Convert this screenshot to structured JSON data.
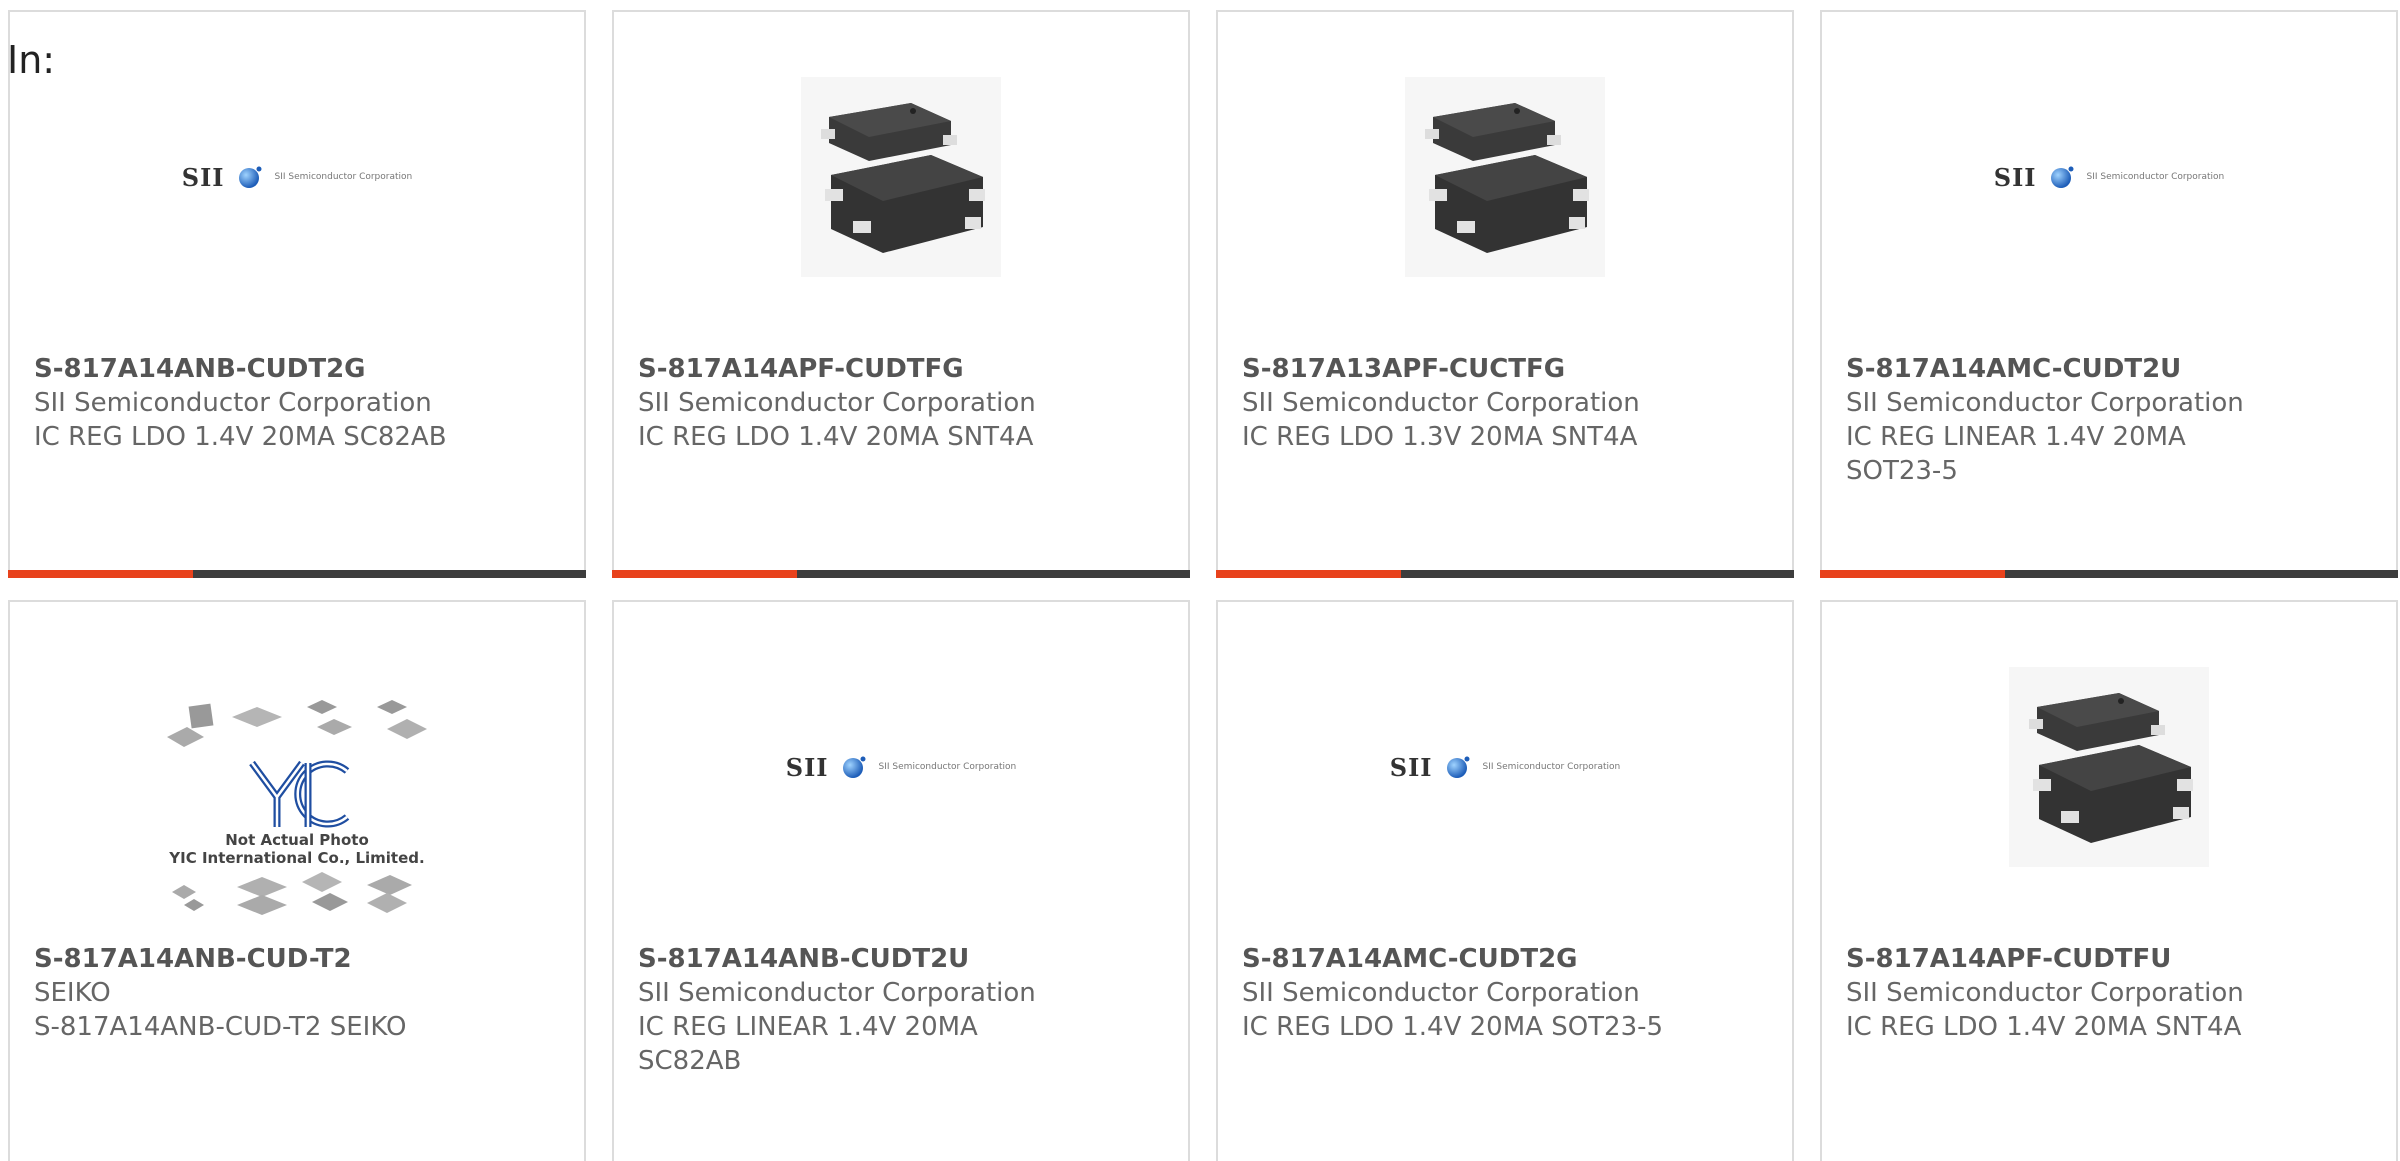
{
  "header": {
    "in_label": "In:"
  },
  "colors": {
    "accent": "#e8421c",
    "bar_track": "#3d3d3d",
    "card_border": "#dcdcdc",
    "text_main": "#666666",
    "text_bold": "#555555"
  },
  "products": [
    {
      "part_number": "S-817A14ANB-CUDT2G",
      "manufacturer": "SII Semiconductor Corporation",
      "desc_line1": "IC REG LDO 1.4V 20MA SC82AB",
      "desc_line2": "",
      "image": "sii-logo",
      "logo_text": "SII",
      "logo_sub": "SII Semiconductor Corporation",
      "progress": 0.32
    },
    {
      "part_number": "S-817A14APF-CUDTFG",
      "manufacturer": "SII Semiconductor Corporation",
      "desc_line1": "IC REG LDO 1.4V 20MA SNT4A",
      "desc_line2": "",
      "image": "chip-photo",
      "progress": 0.32
    },
    {
      "part_number": "S-817A13APF-CUCTFG",
      "manufacturer": "SII Semiconductor Corporation",
      "desc_line1": "IC REG LDO 1.3V 20MA SNT4A",
      "desc_line2": "",
      "image": "chip-photo",
      "progress": 0.32
    },
    {
      "part_number": "S-817A14AMC-CUDT2U",
      "manufacturer": "SII Semiconductor Corporation",
      "desc_line1": "IC REG LINEAR 1.4V 20MA",
      "desc_line2": "SOT23-5",
      "image": "sii-logo",
      "logo_text": "SII",
      "logo_sub": "SII Semiconductor Corporation",
      "progress": 0.32
    },
    {
      "part_number": "S-817A14ANB-CUD-T2",
      "manufacturer": "SEIKO",
      "desc_line1": "S-817A14ANB-CUD-T2 SEIKO",
      "desc_line2": "",
      "image": "yic-placeholder",
      "caption_line1": "Not Actual Photo",
      "caption_line2": "YIC International Co., Limited."
    },
    {
      "part_number": "S-817A14ANB-CUDT2U",
      "manufacturer": "SII Semiconductor Corporation",
      "desc_line1": "IC REG LINEAR 1.4V 20MA",
      "desc_line2": "SC82AB",
      "image": "sii-logo",
      "logo_text": "SII",
      "logo_sub": "SII Semiconductor Corporation"
    },
    {
      "part_number": "S-817A14AMC-CUDT2G",
      "manufacturer": "SII Semiconductor Corporation",
      "desc_line1": "IC REG LDO 1.4V 20MA SOT23-5",
      "desc_line2": "",
      "image": "sii-logo",
      "logo_text": "SII",
      "logo_sub": "SII Semiconductor Corporation"
    },
    {
      "part_number": "S-817A14APF-CUDTFU",
      "manufacturer": "SII Semiconductor Corporation",
      "desc_line1": "IC REG LDO 1.4V 20MA SNT4A",
      "desc_line2": "",
      "image": "chip-photo"
    }
  ]
}
